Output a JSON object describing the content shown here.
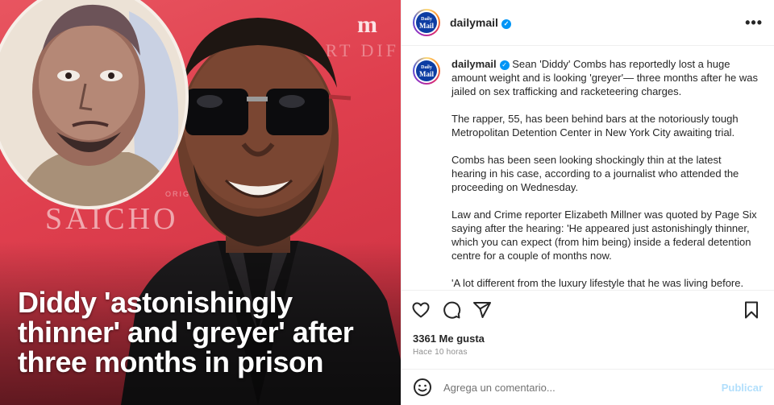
{
  "media": {
    "headline": "Diddy 'astonishingly thinner' and 'greyer' after three months in prison",
    "backdrop_text": "SAICHO",
    "backdrop_small": "ORIGIN",
    "backdrop_side": "ORT DIF",
    "brand_mark": "m",
    "background_color": "#de404e"
  },
  "post": {
    "username": "dailymail",
    "avatar_text_top": "Daily",
    "avatar_text_bottom": "Mail",
    "verified_icon": "verified-check-icon",
    "more_icon": "•••",
    "caption_paragraphs": [
      "Sean 'Diddy' Combs has reportedly lost a huge amount weight and is looking 'greyer'— three months after he was jailed on sex trafficking and racketeering charges.",
      "The rapper, 55, has been behind bars at the notoriously tough Metropolitan Detention Center in New York City awaiting trial.",
      "Combs has been seen looking shockingly thin at the latest hearing in his case, according to a journalist who attended the proceeding on Wednesday.",
      "Law and Crime reporter Elizabeth Millner was quoted by Page Six saying after the hearing: 'He appeared just astonishingly thinner, which you can expect (from him being) inside a federal detention centre for a couple of months now.",
      "'A lot different from the luxury lifestyle that he was living before."
    ],
    "likes": "3361 Me gusta",
    "time_ago": "Hace 10 horas",
    "comment_placeholder": "Agrega un comentario...",
    "publish_label": "Publicar",
    "accent_color": "#0095f6"
  }
}
